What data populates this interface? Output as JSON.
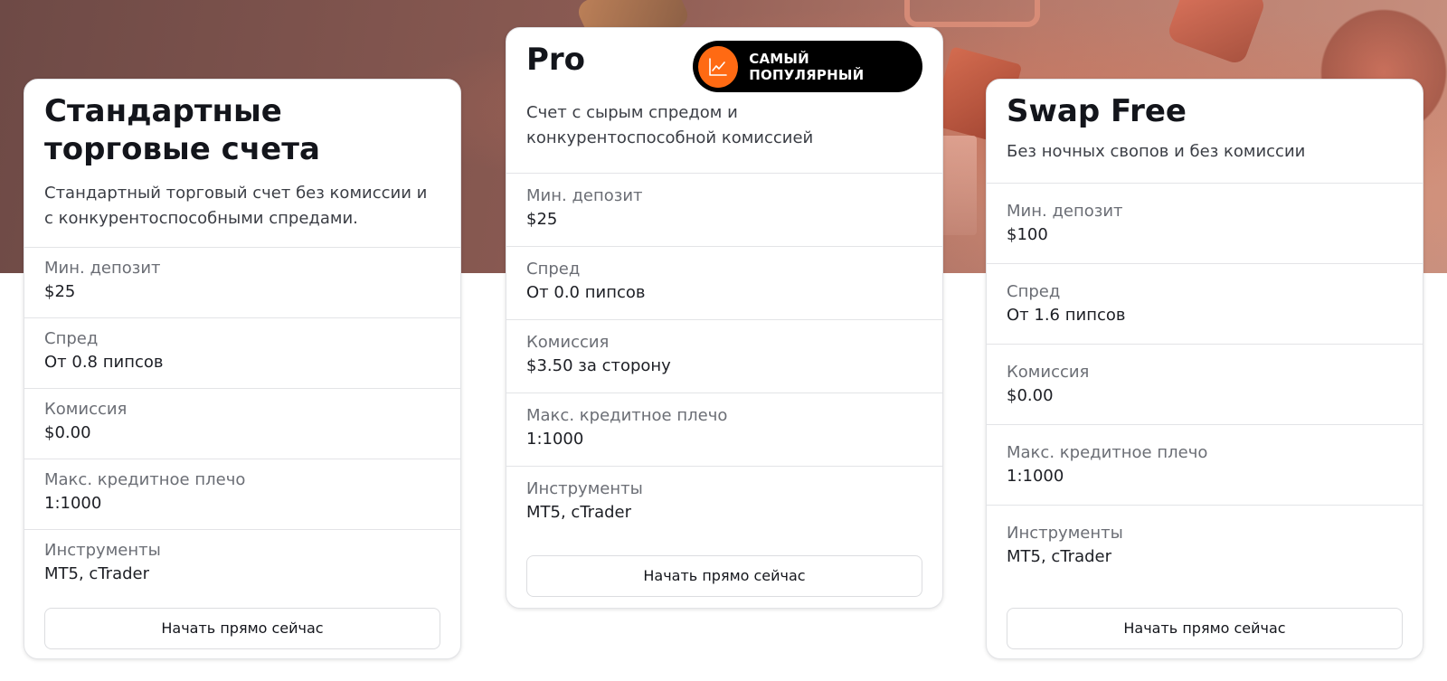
{
  "cards": [
    {
      "title": "Стандартные торговые счета",
      "description": "Стандартный торговый счет без комиссии и с конкурентоспособными спредами.",
      "rows": [
        {
          "label": "Мин. депозит",
          "value": "$25"
        },
        {
          "label": "Спред",
          "value": "От 0.8 пипсов"
        },
        {
          "label": "Комиссия",
          "value": "$0.00"
        },
        {
          "label": "Макс. кредитное плечо",
          "value": "1:1000"
        },
        {
          "label": "Инструменты",
          "value": "MT5, cTrader"
        }
      ],
      "button_label": "Начать прямо сейчас"
    },
    {
      "title": "Pro",
      "badge": {
        "label": "САМЫЙ ПОПУЛЯРНЫЙ",
        "icon": "chart-trend-icon",
        "color": "#ff6a13"
      },
      "description": "Счет с сырым спредом и конкурентоспособной комиссией",
      "rows": [
        {
          "label": "Мин. депозит",
          "value": "$25"
        },
        {
          "label": "Спред",
          "value": "От 0.0 пипсов"
        },
        {
          "label": "Комиссия",
          "value": "$3.50 за сторону"
        },
        {
          "label": "Макс. кредитное плечо",
          "value": "1:1000"
        },
        {
          "label": "Инструменты",
          "value": "MT5, cTrader"
        }
      ],
      "button_label": "Начать прямо сейчас"
    },
    {
      "title": "Swap Free",
      "description": "Без ночных свопов и без комиссии",
      "rows": [
        {
          "label": "Мин. депозит",
          "value": "$100"
        },
        {
          "label": "Спред",
          "value": "От 1.6 пипсов"
        },
        {
          "label": "Комиссия",
          "value": "$0.00"
        },
        {
          "label": "Макс. кредитное плечо",
          "value": "1:1000"
        },
        {
          "label": "Инструменты",
          "value": "MT5, cTrader"
        }
      ],
      "button_label": "Начать прямо сейчас"
    }
  ]
}
